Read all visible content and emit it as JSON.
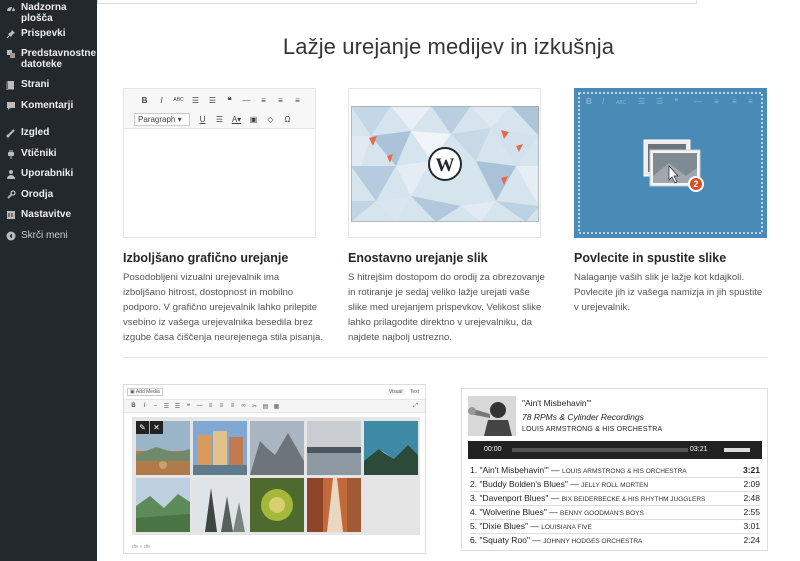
{
  "sidebar": {
    "items": [
      {
        "label": "Nadzorna plošča",
        "icon": "dashboard-icon"
      },
      {
        "label": "Prispevki",
        "icon": "pin-icon"
      },
      {
        "label": "Predstavnostne datoteke",
        "icon": "media-icon"
      },
      {
        "label": "Strani",
        "icon": "page-icon"
      },
      {
        "label": "Komentarji",
        "icon": "comment-icon"
      },
      {
        "label": "Izgled",
        "icon": "brush-icon"
      },
      {
        "label": "Vtičniki",
        "icon": "plugin-icon"
      },
      {
        "label": "Uporabniki",
        "icon": "users-icon"
      },
      {
        "label": "Orodja",
        "icon": "wrench-icon"
      },
      {
        "label": "Nastavitve",
        "icon": "settings-icon"
      },
      {
        "label": "Skrči meni",
        "icon": "collapse-icon"
      }
    ]
  },
  "main": {
    "headline": "Lažje urejanje medijev in izkušnja",
    "features": [
      {
        "title": "Izboljšano grafično urejanje",
        "text": "Posodobljeni vizualni urejevalnik ima izboljšano hitrost, dostopnost in mobilno podporo. V grafično urejevalnik lahko prilepite vsebino iz vašega urejevalnika besedila brez izgube časa čiščenja neurejenega stila pisanja."
      },
      {
        "title": "Enostavno urejanje slik",
        "text": "S hitrejšim dostopom do orodij za obrezovanje in rotiranje je sedaj veliko lažje urejati vaše slike med urejanjem prispevkov. Velikost slike lahko prilagodite direktno v urejevalniku, da najdete najbolj ustrezno."
      },
      {
        "title": "Povlecite in spustite slike",
        "text": "Nalaganje vaših slik je lažje kot kdajkoli. Povlecite jih iz vašega namizja in jih spustite v urejevalnik."
      }
    ],
    "editor": {
      "paragraph_label": "Paragraph"
    },
    "dropzone": {
      "badge": "2"
    },
    "gallery": {
      "add_media": "Add Media",
      "tab_visual": "Visual",
      "tab_text": "Text",
      "footer_path": "div » div"
    },
    "audio": {
      "title": "\"Ain't Misbehavin'\"",
      "album": "78 RPMs & Cylinder Recordings",
      "artist": "LOUIS ARMSTRONG & HIS ORCHESTRA",
      "time_current": "00:00",
      "time_total": "03:21",
      "tracks": [
        {
          "num": "1.",
          "name": "\"Ain't Misbehavin'\"",
          "artist": "LOUIS ARMSTRONG & HIS ORCHESTRA",
          "time": "3:21"
        },
        {
          "num": "2.",
          "name": "\"Buddy Bolden's Blues\"",
          "artist": "JELLY ROLL MORTEN",
          "time": "2:09"
        },
        {
          "num": "3.",
          "name": "\"Davenport Blues\"",
          "artist": "BIX BEIDERBECKE & HIS RHYTHM JUGGLERS",
          "time": "2:48"
        },
        {
          "num": "4.",
          "name": "\"Wolverine Blues\"",
          "artist": "BENNY GOODMAN'S BOYS",
          "time": "2:55"
        },
        {
          "num": "5.",
          "name": "\"Dixie Blues\"",
          "artist": "LOUISIANA FIVE",
          "time": "3:01"
        },
        {
          "num": "6.",
          "name": "\"Squaty Roo\"",
          "artist": "JOHNNY HODGES ORCHESTRA",
          "time": "2:24"
        }
      ]
    }
  }
}
